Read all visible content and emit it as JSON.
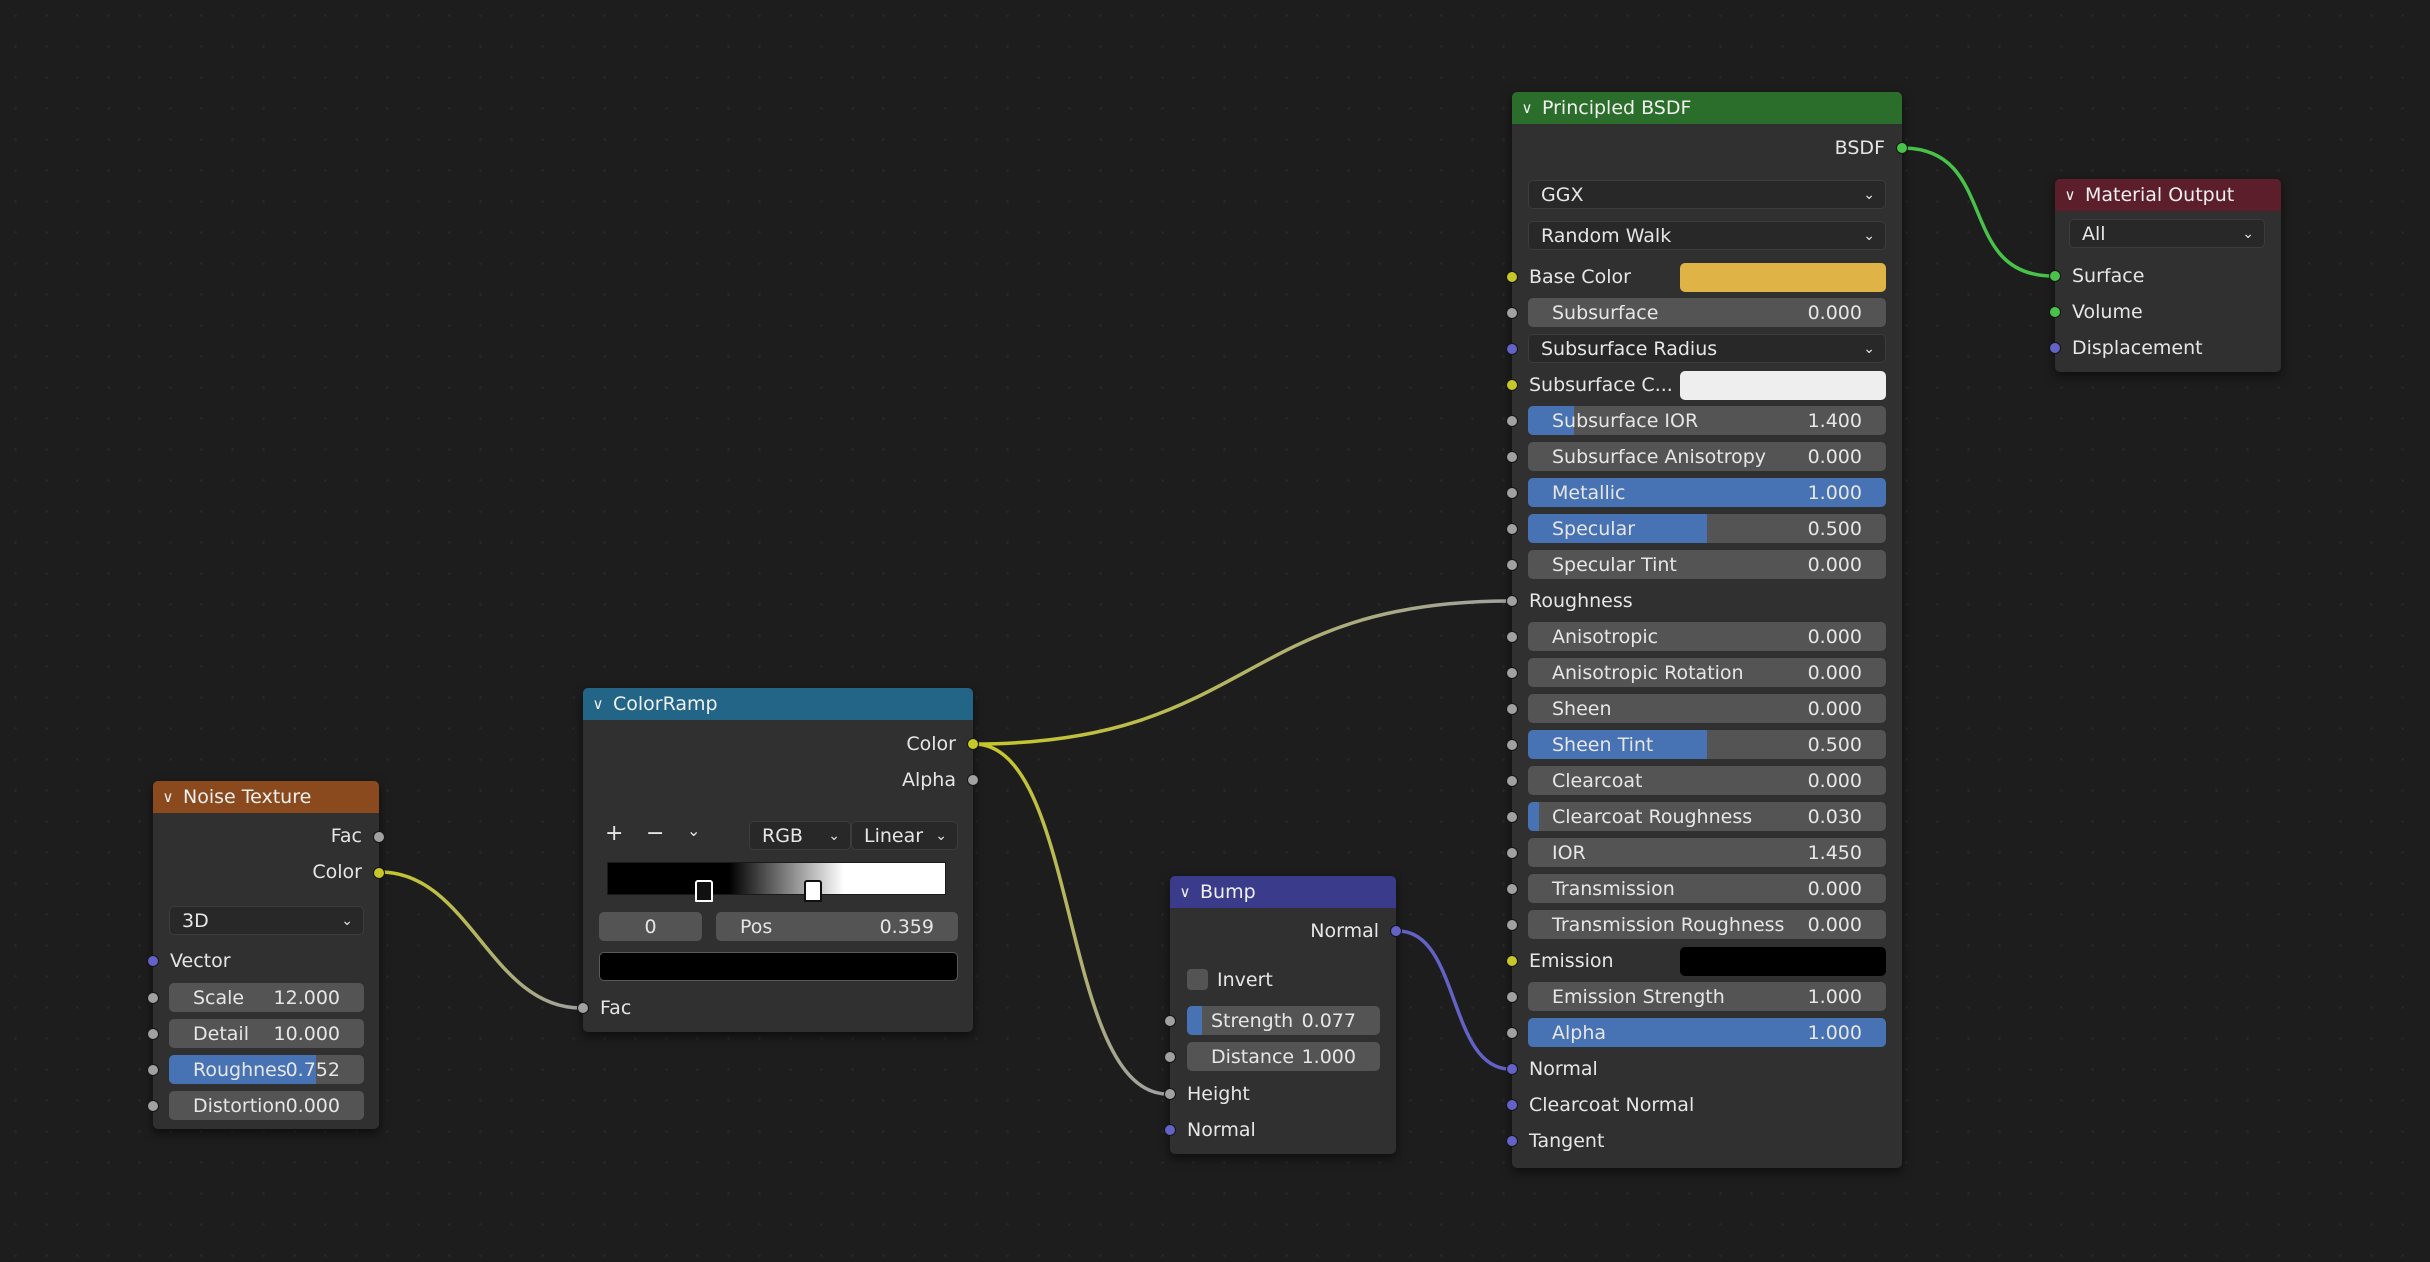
{
  "colors": {
    "background": "#1d1d1d",
    "node_body": "#303030",
    "field": "#545454",
    "field_fill": "#4772b3",
    "header_noise": "#8b4a1e",
    "header_colorramp": "#236586",
    "header_bump": "#3a3b8a",
    "header_bsdf": "#2b6e2b",
    "header_output": "#5b1e2a",
    "base_color": "#e0b347",
    "subsurface_color": "#eeeeee",
    "emission": "#000000"
  },
  "noise": {
    "title": "Noise Texture",
    "out_fac": "Fac",
    "out_color": "Color",
    "dimensions": "3D",
    "in_vector": "Vector",
    "scale_label": "Scale",
    "scale_value": "12.000",
    "detail_label": "Detail",
    "detail_value": "10.000",
    "roughness_label": "Roughnes",
    "roughness_value": "0.752",
    "roughness_fraction": 0.752,
    "distortion_label": "Distortion",
    "distortion_value": "0.000"
  },
  "colorramp": {
    "title": "ColorRamp",
    "out_color": "Color",
    "out_alpha": "Alpha",
    "add_icon": "plus-icon",
    "remove_icon": "minus-icon",
    "menu_icon": "chevron-down-icon",
    "color_mode": "RGB",
    "interpolation": "Linear",
    "stop_index": "0",
    "pos_label": "Pos",
    "pos_value": "0.359",
    "selected_color": "#000000",
    "in_fac": "Fac"
  },
  "bump": {
    "title": "Bump",
    "out_normal": "Normal",
    "invert_label": "Invert",
    "invert_checked": false,
    "strength_label": "Strength",
    "strength_value": "0.077",
    "strength_fraction": 0.077,
    "distance_label": "Distance",
    "distance_value": "1.000",
    "in_height": "Height",
    "in_normal": "Normal"
  },
  "bsdf": {
    "title": "Principled BSDF",
    "out_bsdf": "BSDF",
    "distribution": "GGX",
    "subsurface_method": "Random Walk",
    "base_color_label": "Base Color",
    "subsurface_label": "Subsurface",
    "subsurface_value": "0.000",
    "subsurface_radius_label": "Subsurface Radius",
    "subsurface_color_label": "Subsurface C...",
    "subsurface_ior_label": "Subsurface IOR",
    "subsurface_ior_value": "1.400",
    "subsurface_aniso_label": "Subsurface Anisotropy",
    "subsurface_aniso_value": "0.000",
    "metallic_label": "Metallic",
    "metallic_value": "1.000",
    "metallic_fraction": 1.0,
    "specular_label": "Specular",
    "specular_value": "0.500",
    "specular_fraction": 0.5,
    "specular_tint_label": "Specular Tint",
    "specular_tint_value": "0.000",
    "roughness_label": "Roughness",
    "anisotropic_label": "Anisotropic",
    "anisotropic_value": "0.000",
    "aniso_rotation_label": "Anisotropic Rotation",
    "aniso_rotation_value": "0.000",
    "sheen_label": "Sheen",
    "sheen_value": "0.000",
    "sheen_tint_label": "Sheen Tint",
    "sheen_tint_value": "0.500",
    "sheen_tint_fraction": 0.5,
    "clearcoat_label": "Clearcoat",
    "clearcoat_value": "0.000",
    "clearcoat_rough_label": "Clearcoat Roughness",
    "clearcoat_rough_value": "0.030",
    "clearcoat_rough_fraction": 0.03,
    "ior_label": "IOR",
    "ior_value": "1.450",
    "transmission_label": "Transmission",
    "transmission_value": "0.000",
    "trans_rough_label": "Transmission Roughness",
    "trans_rough_value": "0.000",
    "emission_label": "Emission",
    "emission_strength_label": "Emission Strength",
    "emission_strength_value": "1.000",
    "alpha_label": "Alpha",
    "alpha_value": "1.000",
    "alpha_fraction": 1.0,
    "normal_label": "Normal",
    "clearcoat_normal_label": "Clearcoat Normal",
    "tangent_label": "Tangent"
  },
  "output": {
    "title": "Material Output",
    "target": "All",
    "surface_label": "Surface",
    "volume_label": "Volume",
    "displacement_label": "Displacement"
  }
}
